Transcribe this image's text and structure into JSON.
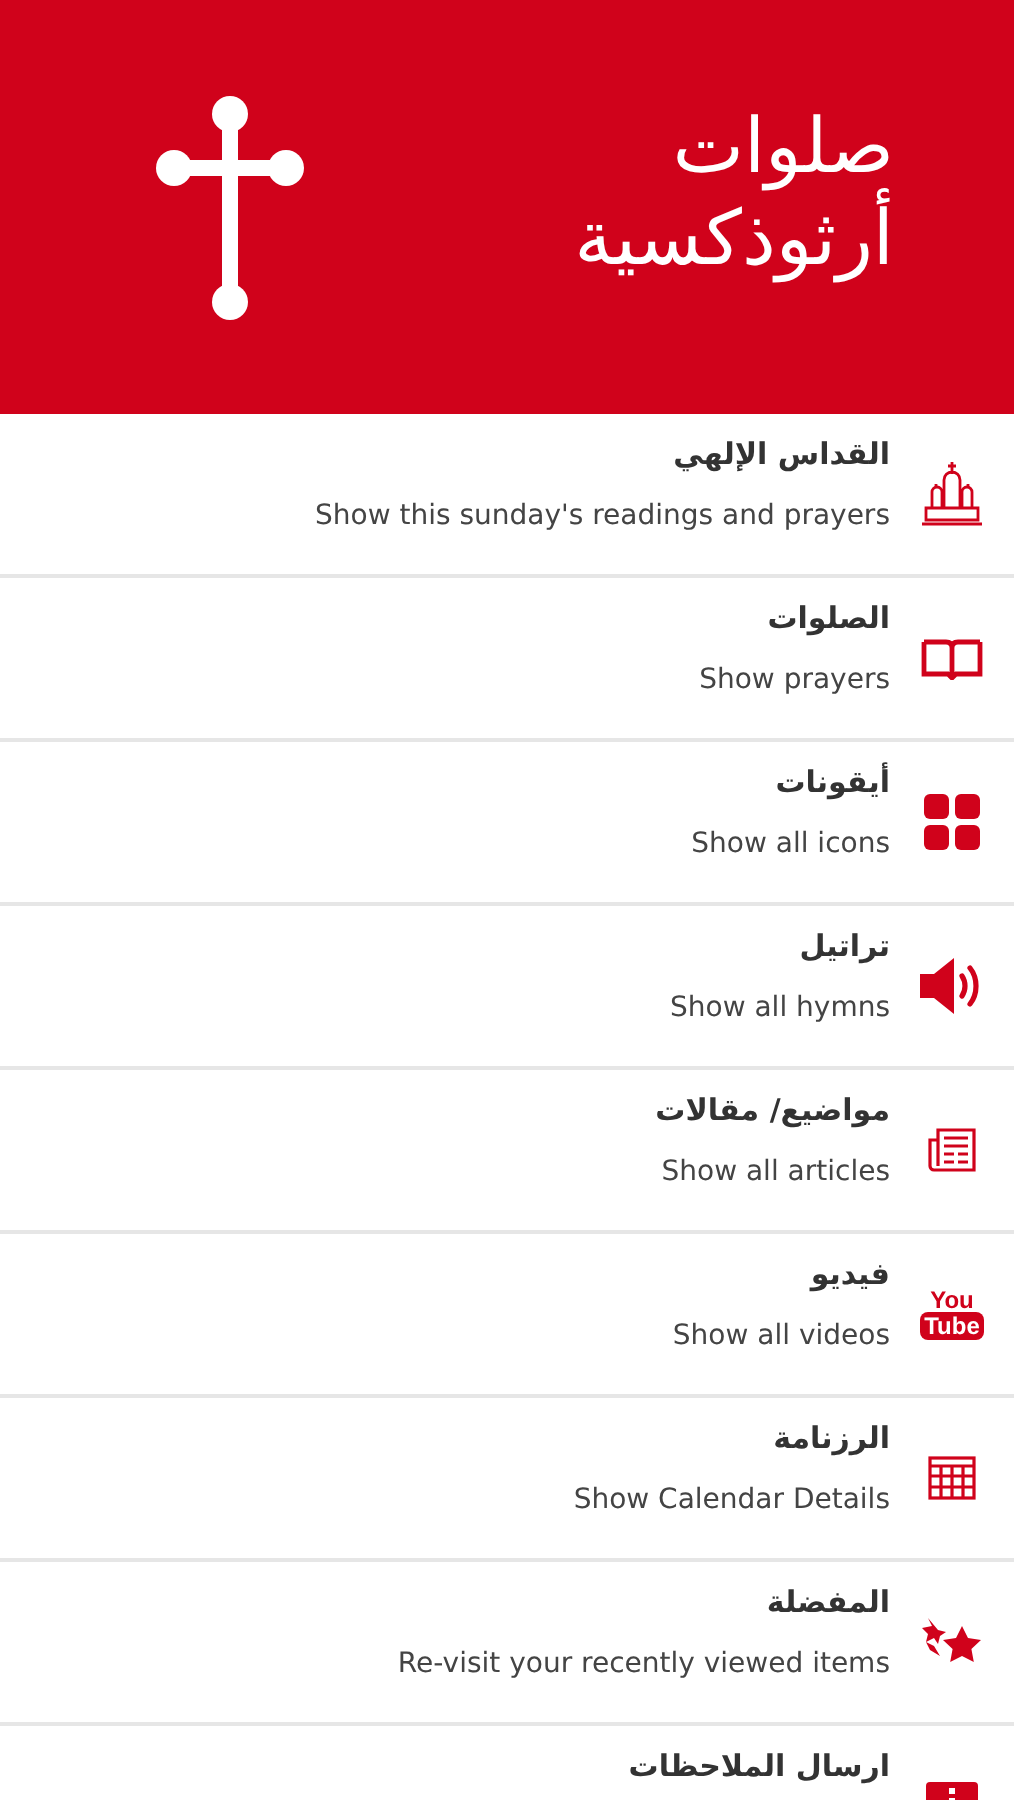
{
  "header": {
    "title_lines": [
      "صلوات",
      "أرثوذكسية"
    ]
  },
  "menu": [
    {
      "kind": "church",
      "title": "القداس الإلهي",
      "subtitle": "Show this sunday's readings and prayers"
    },
    {
      "kind": "book",
      "title": "الصلوات",
      "subtitle": "Show prayers"
    },
    {
      "kind": "grid",
      "title": "أيقونات",
      "subtitle": "Show all icons"
    },
    {
      "kind": "speaker",
      "title": "تراتيل",
      "subtitle": "Show all hymns"
    },
    {
      "kind": "newspaper",
      "title": "مواضيع/ مقالات",
      "subtitle": "Show all articles"
    },
    {
      "kind": "video",
      "title": "فيديو",
      "subtitle": "Show all videos",
      "logo_text": [
        "You",
        "Tube"
      ]
    },
    {
      "kind": "calendar",
      "title": "الرزنامة",
      "subtitle": "Show Calendar Details"
    },
    {
      "kind": "stars",
      "title": "المفضلة",
      "subtitle": "Re-visit your recently viewed items"
    },
    {
      "kind": "feedback",
      "title": "ارسال الملاحظات"
    }
  ]
}
